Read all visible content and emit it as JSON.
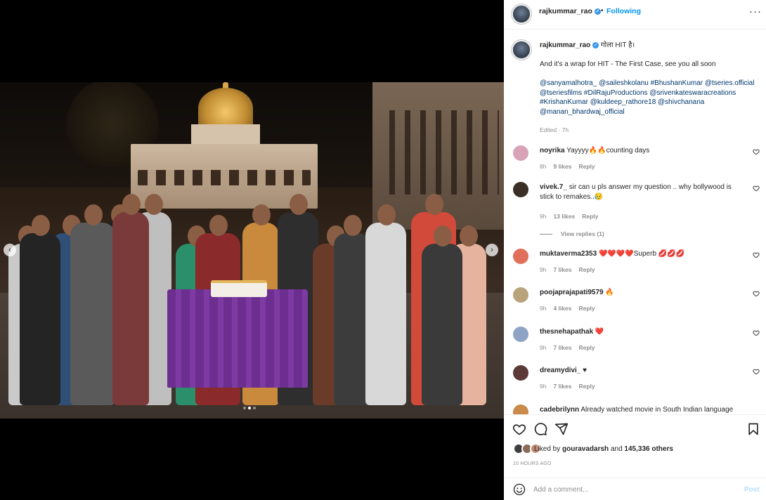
{
  "header": {
    "username": "rajkummar_rao",
    "verified_mark": "✓",
    "separator": "•",
    "follow_status": "Following",
    "more_label": "···"
  },
  "media": {
    "prev_label": "‹",
    "next_label": "›",
    "slide_count": 3,
    "active_slide": 2
  },
  "caption": {
    "username": "rajkummar_rao",
    "line1": "गोला HIT है।",
    "line2": "And it's a wrap for HIT - The First Case, see you all soon",
    "tags": "@sanyamalhotra_ @saileshkolanu #BhushanKumar @tseries.official @tseriesfilms #DilRajuProductions @srivenkateswaracreations #KrishanKumar @kuldeep_rathore18 @shivchanana @manan_bhardwaj_official",
    "edited": "Edited · 7h"
  },
  "comments": [
    {
      "user": "noyrika",
      "text": "Yayyyy🔥🔥counting days",
      "age": "8h",
      "likes": "9 likes",
      "reply": "Reply",
      "avatar_color": "#d9a3b7"
    },
    {
      "user": "vivek.7_",
      "text": "sir can u pls answer my question .. why bollywood is stick to remakes..😥",
      "age": "9h",
      "likes": "13 likes",
      "reply": "Reply",
      "avatar_color": "#3b2e27",
      "view_replies": "View replies (1)"
    },
    {
      "user": "muktaverma2353",
      "text": "❤️❤️❤️❤️Superb 💋💋💋",
      "age": "9h",
      "likes": "7 likes",
      "reply": "Reply",
      "avatar_color": "#e0705a"
    },
    {
      "user": "poojaprajapati9579",
      "text": "🔥",
      "age": "9h",
      "likes": "4 likes",
      "reply": "Reply",
      "avatar_color": "#b9a37a"
    },
    {
      "user": "thesnehapathak",
      "text": "❤️",
      "age": "9h",
      "likes": "7 likes",
      "reply": "Reply",
      "avatar_color": "#8fa4c4"
    },
    {
      "user": "dreamydivi_",
      "text": "♥",
      "age": "9h",
      "likes": "7 likes",
      "reply": "Reply",
      "avatar_color": "#5b3a37"
    },
    {
      "user": "cadebrilynn",
      "text": "Already watched movie in South Indian language",
      "age": "",
      "likes": "",
      "reply": "",
      "avatar_color": "#c98a4a"
    }
  ],
  "actions": {
    "liked_by_prefix": "Liked by",
    "liked_by_user": "gouravadarsh",
    "and_text": "and",
    "others": "145,336 others",
    "time_ago": "10 HOURS AGO"
  },
  "add_comment": {
    "placeholder": "Add a comment...",
    "post_label": "Post"
  },
  "icons": {
    "heart": "heart-icon",
    "comment": "comment-icon",
    "share": "share-icon",
    "save": "bookmark-icon",
    "emoji": "emoji-icon",
    "more": "more-icon"
  },
  "colors": {
    "accent": "#0095f6",
    "post_disabled": "#b2dffc",
    "verified": "#3897f0",
    "tag": "#00376b",
    "table_cloth": "#7d3aa3"
  }
}
